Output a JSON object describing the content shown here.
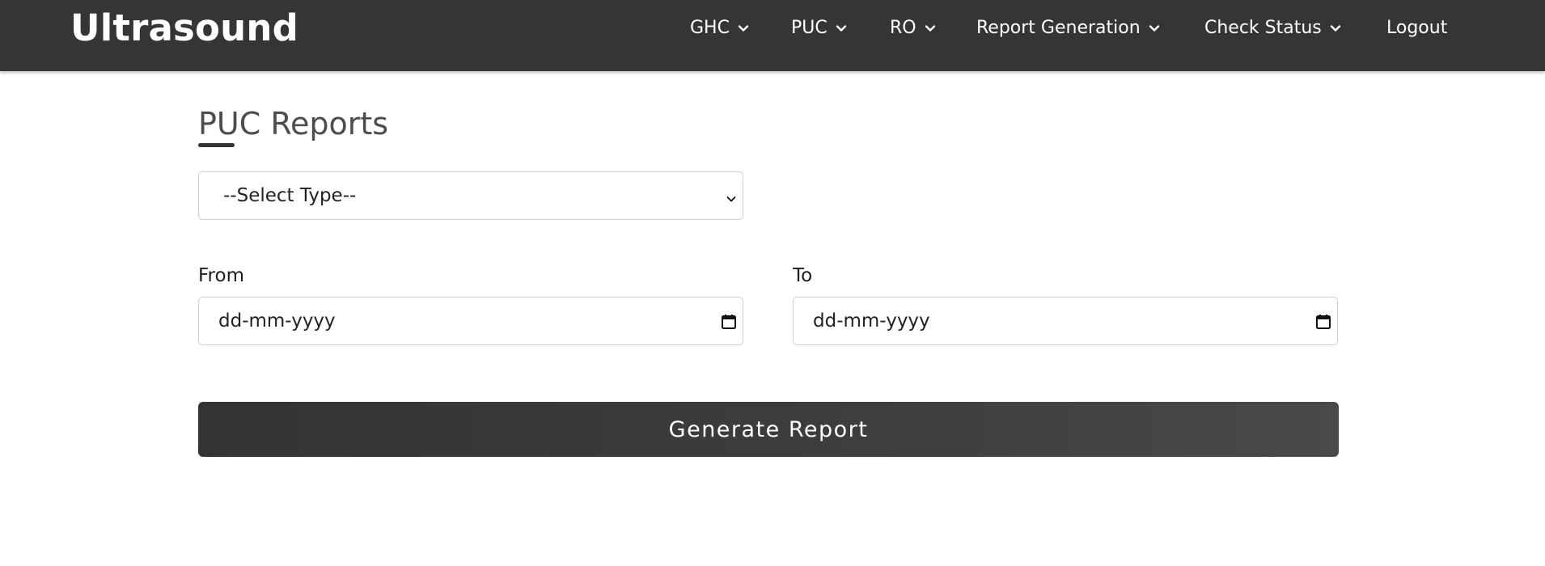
{
  "app": {
    "brand": "Ultrasound"
  },
  "nav": {
    "items": [
      {
        "label": "GHC",
        "has_dropdown": true
      },
      {
        "label": "PUC",
        "has_dropdown": true
      },
      {
        "label": "RO",
        "has_dropdown": true
      },
      {
        "label": "Report Generation",
        "has_dropdown": true
      },
      {
        "label": "Check Status",
        "has_dropdown": true
      },
      {
        "label": "Logout",
        "has_dropdown": false
      }
    ]
  },
  "page": {
    "title": "PUC Reports"
  },
  "form": {
    "type_select": {
      "selected": "--Select Type--"
    },
    "from": {
      "label": "From",
      "placeholder": "dd-mm-yyyy"
    },
    "to": {
      "label": "To",
      "placeholder": "dd-mm-yyyy"
    },
    "submit_label": "Generate Report"
  },
  "colors": {
    "navbar_bg": "#353535",
    "button_bg": "#3d3d3d",
    "title_text": "#4d4d4d"
  },
  "icons": {
    "dropdown": "chevron-down-icon",
    "calendar": "calendar-icon"
  }
}
